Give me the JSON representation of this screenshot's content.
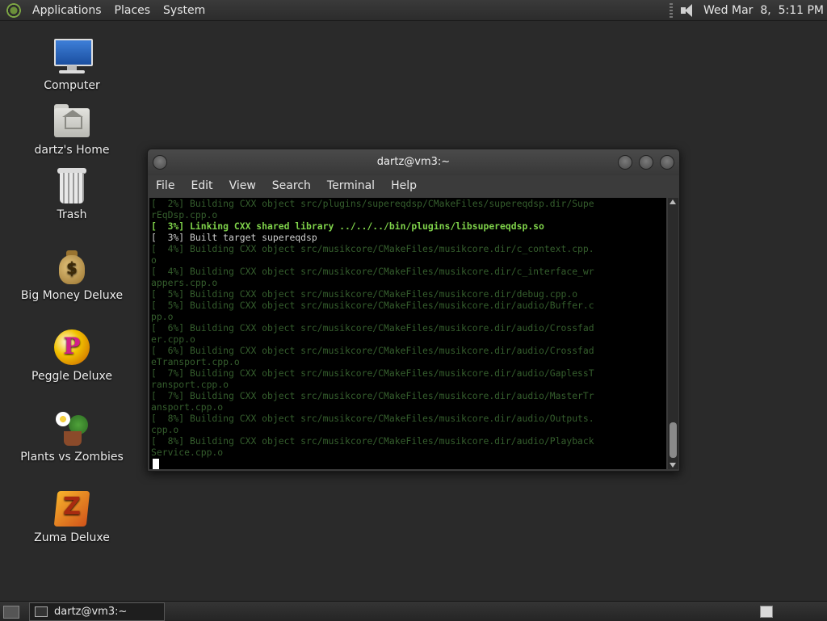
{
  "top_panel": {
    "menus": [
      "Applications",
      "Places",
      "System"
    ],
    "clock": "Wed Mar  8,  5:11 PM"
  },
  "desktop_icons": [
    {
      "label": "Computer",
      "icon": "computer-icon"
    },
    {
      "label": "dartz's Home",
      "icon": "home-folder-icon"
    },
    {
      "label": "Trash",
      "icon": "trash-icon"
    },
    {
      "label": "Big Money Deluxe",
      "icon": "money-bag-icon"
    },
    {
      "label": "Peggle Deluxe",
      "icon": "peggle-icon"
    },
    {
      "label": "Plants vs Zombies",
      "icon": "plants-vs-zombies-icon"
    },
    {
      "label": "Zuma Deluxe",
      "icon": "zuma-icon"
    }
  ],
  "terminal": {
    "title": "dartz@vm3:~",
    "menu": [
      "File",
      "Edit",
      "View",
      "Search",
      "Terminal",
      "Help"
    ],
    "lines": [
      {
        "text": "[  2%] Building CXX object src/plugins/supereqdsp/CMakeFiles/supereqdsp.dir/Supe",
        "style": "dim"
      },
      {
        "text": "rEqDsp.cpp.o",
        "style": "dim"
      },
      {
        "text": "[  3%] Linking CXX shared library ../../../bin/plugins/libsupereqdsp.so",
        "style": "bold"
      },
      {
        "text": "[  3%] Built target supereqdsp",
        "style": "normal"
      },
      {
        "text": "[  4%] Building CXX object src/musikcore/CMakeFiles/musikcore.dir/c_context.cpp.",
        "style": "dim"
      },
      {
        "text": "o",
        "style": "dim"
      },
      {
        "text": "[  4%] Building CXX object src/musikcore/CMakeFiles/musikcore.dir/c_interface_wr",
        "style": "dim"
      },
      {
        "text": "appers.cpp.o",
        "style": "dim"
      },
      {
        "text": "[  5%] Building CXX object src/musikcore/CMakeFiles/musikcore.dir/debug.cpp.o",
        "style": "dim"
      },
      {
        "text": "[  5%] Building CXX object src/musikcore/CMakeFiles/musikcore.dir/audio/Buffer.c",
        "style": "dim"
      },
      {
        "text": "pp.o",
        "style": "dim"
      },
      {
        "text": "[  6%] Building CXX object src/musikcore/CMakeFiles/musikcore.dir/audio/Crossfad",
        "style": "dim"
      },
      {
        "text": "er.cpp.o",
        "style": "dim"
      },
      {
        "text": "[  6%] Building CXX object src/musikcore/CMakeFiles/musikcore.dir/audio/Crossfad",
        "style": "dim"
      },
      {
        "text": "eTransport.cpp.o",
        "style": "dim"
      },
      {
        "text": "[  7%] Building CXX object src/musikcore/CMakeFiles/musikcore.dir/audio/GaplessT",
        "style": "dim"
      },
      {
        "text": "ransport.cpp.o",
        "style": "dim"
      },
      {
        "text": "[  7%] Building CXX object src/musikcore/CMakeFiles/musikcore.dir/audio/MasterTr",
        "style": "dim"
      },
      {
        "text": "ansport.cpp.o",
        "style": "dim"
      },
      {
        "text": "[  8%] Building CXX object src/musikcore/CMakeFiles/musikcore.dir/audio/Outputs.",
        "style": "dim"
      },
      {
        "text": "cpp.o",
        "style": "dim"
      },
      {
        "text": "[  8%] Building CXX object src/musikcore/CMakeFiles/musikcore.dir/audio/Playback",
        "style": "dim"
      },
      {
        "text": "Service.cpp.o",
        "style": "dim"
      }
    ]
  },
  "taskbar": {
    "task_label": "dartz@vm3:~"
  }
}
